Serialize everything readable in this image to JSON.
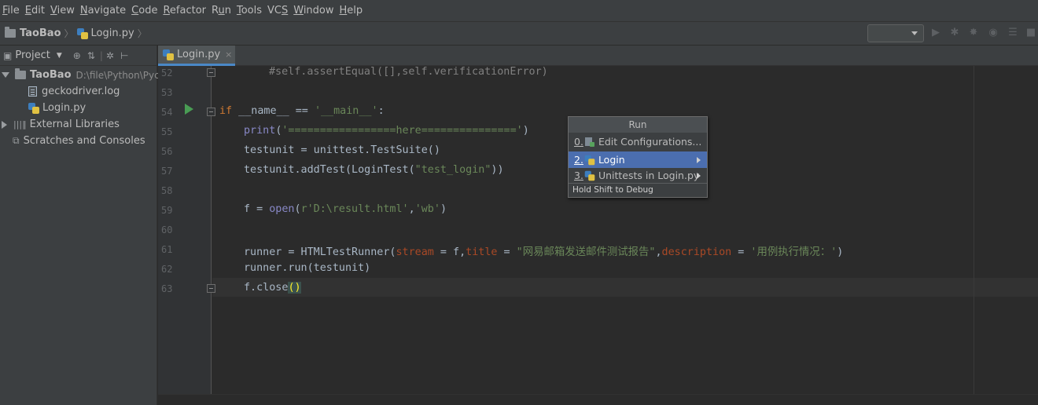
{
  "menu": [
    {
      "mnemonic": "F",
      "rest": "ile"
    },
    {
      "mnemonic": "E",
      "rest": "dit"
    },
    {
      "mnemonic": "V",
      "rest": "iew"
    },
    {
      "mnemonic": "N",
      "rest": "avigate"
    },
    {
      "mnemonic": "C",
      "rest": "ode"
    },
    {
      "mnemonic": "R",
      "rest": "efactor"
    },
    {
      "pre": "R",
      "mnemonic": "u",
      "rest": "n"
    },
    {
      "mnemonic": "T",
      "rest": "ools"
    },
    {
      "pre": "VC",
      "mnemonic": "S",
      "rest": ""
    },
    {
      "mnemonic": "W",
      "rest": "indow"
    },
    {
      "mnemonic": "H",
      "rest": "elp"
    }
  ],
  "breadcrumb": {
    "project": "TaoBao",
    "file": "Login.py"
  },
  "project_panel": {
    "title": "Project",
    "root": {
      "name": "TaoBao",
      "path": "D:\\file\\Python\\Pycha"
    },
    "files": [
      "geckodriver.log",
      "Login.py"
    ],
    "external": "External Libraries",
    "scratches": "Scratches and Consoles"
  },
  "editor_tab": {
    "label": "Login.py",
    "close": "×"
  },
  "line_numbers": [
    "52",
    "53",
    "54",
    "55",
    "56",
    "57",
    "58",
    "59",
    "60",
    "61",
    "62",
    "63"
  ],
  "code": {
    "l52": "#self.assertEqual([],self.verificationError)",
    "l54_kw": "if",
    "l54_rest": " __name__ == ",
    "l54_str": "'__main__'",
    "l54_end": ":",
    "l55_fn": "print",
    "l55_open": "(",
    "l55_str": "'=================here==============='",
    "l55_close": ")",
    "l56": "testunit = unittest.TestSuite()",
    "l57_a": "testunit.addTest(LoginTest(",
    "l57_str": "\"test_login\"",
    "l57_b": "))",
    "l59_a": "f = ",
    "l59_fn": "open",
    "l59_b": "(",
    "l59_str1": "r'D:\\result.html'",
    "l59_c": ",",
    "l59_str2": "'wb'",
    "l59_d": ")",
    "l61_a": "runner = HTMLTestRunner(",
    "l61_p1": "stream",
    "l61_b": " = f,",
    "l61_p2": "title",
    "l61_c": " = ",
    "l61_str1": "\"网易邮箱发送邮件测试报告\"",
    "l61_d": ",",
    "l61_p3": "description",
    "l61_e": " = ",
    "l61_str2": "'用例执行情况：'",
    "l61_f": ")",
    "l62": "runner.run(testunit)",
    "l63_a": "f.close",
    "l63_b": "()"
  },
  "run_popup": {
    "title": "Run",
    "items": [
      {
        "num": "0.",
        "label": "Edit Configurations..."
      },
      {
        "num": "2.",
        "label": "Login"
      },
      {
        "num": "3.",
        "label": "Unittests in Login.py"
      }
    ],
    "footer": "Hold Shift to Debug"
  }
}
